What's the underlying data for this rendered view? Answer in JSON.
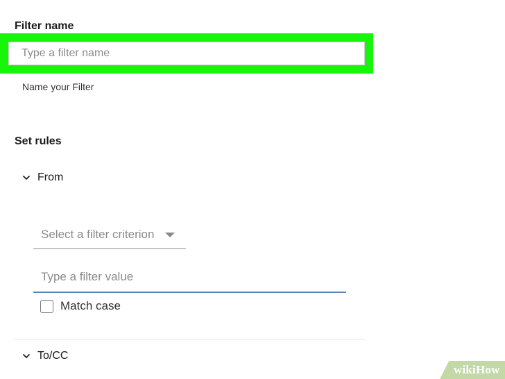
{
  "filter_name": {
    "title": "Filter name",
    "placeholder": "Type a filter name",
    "helper": "Name your Filter"
  },
  "rules": {
    "title": "Set rules",
    "groups": [
      {
        "label": "From",
        "expanded": true
      },
      {
        "label": "To/CC",
        "expanded": false
      }
    ],
    "criterion_placeholder": "Select a filter criterion",
    "value_placeholder": "Type a filter value",
    "match_case_label": "Match case",
    "match_case_checked": false
  },
  "colors": {
    "highlight": "#17f50a",
    "input_focus_underline": "#5a86b5"
  },
  "icons": {
    "group_toggle": "chevron-down-icon",
    "select_caret": "caret-down-icon"
  },
  "watermark": "wikiHow"
}
